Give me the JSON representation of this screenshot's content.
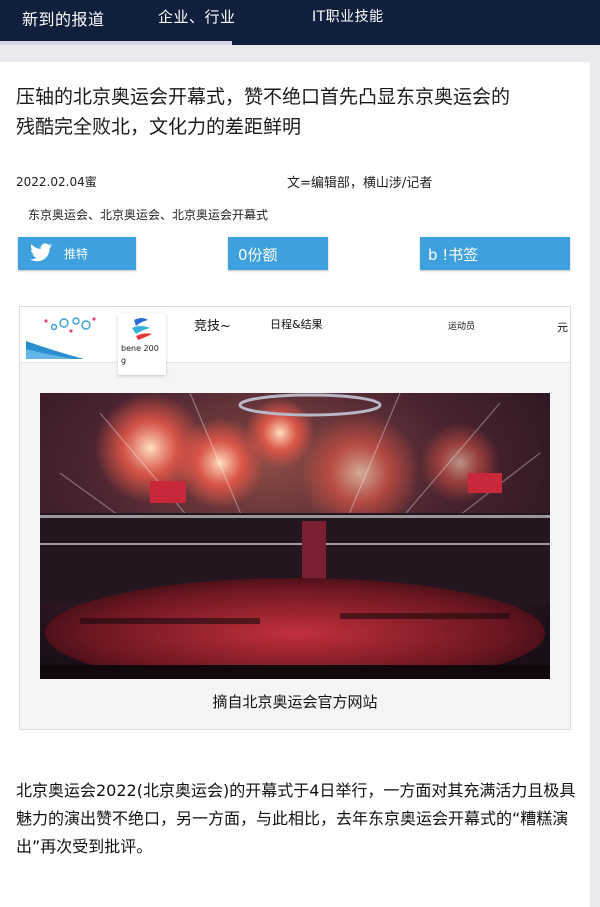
{
  "nav": {
    "tabs": [
      {
        "label": "新到的报道",
        "active": true
      },
      {
        "label": "企业、行业",
        "active": false
      },
      {
        "label": "IT职业技能",
        "active": false
      }
    ]
  },
  "article": {
    "headline_line1": "压轴的北京奥运会开幕式，赞不绝口首先凸显东京奥运会的",
    "headline_line2": "残酷完全败北，文化力的差距鲜明",
    "date": "2022.02.04蜜",
    "author": "文=编辑部，横山涉/记者",
    "tags": "东京奥运会、北京奥运会、北京奥运会开幕式",
    "body": "北京奥运会2022(北京奥运会)的开幕式于4日举行，一方面对其充满活力且极具魅力的演出赞不绝口，另一方面，与此相比，去年东京奥运会开幕式的“糟糕演出”再次受到批评。"
  },
  "share": {
    "twitter_label": "推特",
    "share_label": "0份额",
    "bookmark_label": "b !书签",
    "icons": {
      "twitter": "twitter-bird-icon"
    }
  },
  "embed": {
    "emblem_text": "bene 200 g",
    "nav": [
      "竞技~",
      "日程&结果",
      "运动员",
      "元"
    ],
    "caption": "摘自北京奥运会官方网站"
  },
  "colors": {
    "nav_bg": "#0f1f3c",
    "share_blue": "#3fa0de",
    "page_bg": "#e9ebef"
  }
}
